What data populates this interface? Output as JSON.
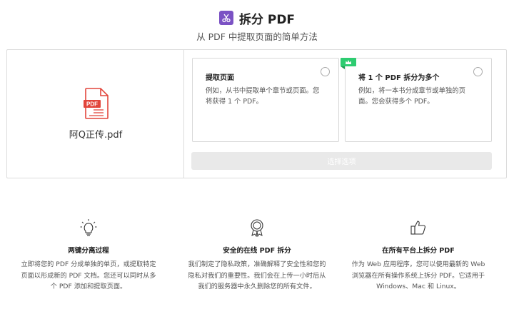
{
  "header": {
    "title": "拆分 PDF",
    "subtitle": "从 PDF 中提取页面的简单方法"
  },
  "file": {
    "name": "阿Q正传.pdf",
    "icon_label": "PDF"
  },
  "options": [
    {
      "title": "提取页面",
      "desc": "例如，从书中提取单个章节或页面。您将获得 1 个 PDF。"
    },
    {
      "title": "将 1 个 PDF 拆分为多个",
      "desc": "例如，将一本书分成章节或单独的页面。您会获得多个 PDF。"
    }
  ],
  "select_button": "选择选项",
  "features": [
    {
      "title": "两键分离过程",
      "desc": "立即将您的 PDF 分成单独的单页，或提取特定页面以形成新的 PDF 文档。您还可以同时从多个 PDF 添加和提取页面。"
    },
    {
      "title": "安全的在线 PDF 拆分",
      "desc": "我们制定了隐私政策，准确解释了安全性和您的隐私对我们的重要性。我们会在上传一小时后从我们的服务器中永久删除您的所有文件。"
    },
    {
      "title": "在所有平台上拆分 PDF",
      "desc": "作为 Web 应用程序，您可以使用最新的 Web 浏览器在所有操作系统上拆分 PDF。它适用于 Windows、Mac 和 Linux。"
    }
  ],
  "colors": {
    "brand": "#7b52c4",
    "pdf_red": "#e2453b",
    "badge_green": "#2ecc71"
  }
}
